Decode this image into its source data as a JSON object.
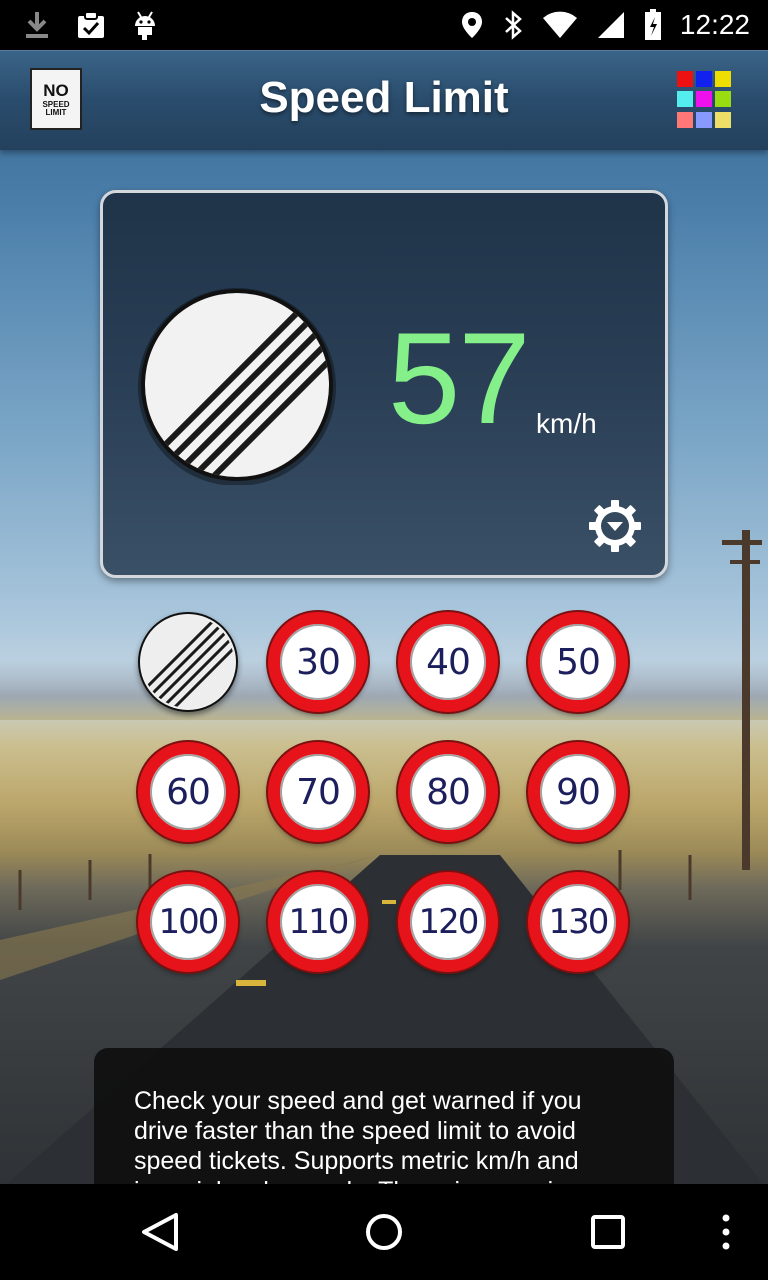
{
  "status_bar": {
    "time": "12:22",
    "left_icons": [
      "download-icon",
      "clipboard-check-icon",
      "android-icon"
    ],
    "right_icons": [
      "location-icon",
      "bluetooth-icon",
      "wifi-icon",
      "cell-signal-icon",
      "battery-icon"
    ]
  },
  "app_bar": {
    "title": "Speed Limit",
    "logo": {
      "line1": "NO",
      "line2": "SPEED",
      "line3": "LIMIT"
    },
    "apps_grid_colors": [
      "#ee1111",
      "#1122ee",
      "#eedd00",
      "#55eeee",
      "#ee11ee",
      "#99dd11",
      "#ff7777",
      "#8899ff",
      "#eedd66"
    ]
  },
  "speed_panel": {
    "current_sign": "no-speed-limit",
    "speed": "57",
    "unit": "km/h",
    "speed_color": "#85f08a"
  },
  "limits": {
    "buttons": [
      {
        "label": "",
        "type": "no-limit"
      },
      {
        "label": "30"
      },
      {
        "label": "40"
      },
      {
        "label": "50"
      },
      {
        "label": "60"
      },
      {
        "label": "70"
      },
      {
        "label": "80"
      },
      {
        "label": "90"
      },
      {
        "label": "100"
      },
      {
        "label": "110"
      },
      {
        "label": "120"
      },
      {
        "label": "130"
      }
    ],
    "ring_color": "#e6141a",
    "number_color": "#1c1f5c"
  },
  "description": {
    "text": "Check your speed and get warned if you drive faster than the speed limit to avoid speed tickets. Supports metric km/h and imperial mph speeds. The voice warning alarm"
  },
  "nav_bar": {
    "buttons": [
      "back-icon",
      "home-icon",
      "recents-icon",
      "more-icon"
    ]
  }
}
